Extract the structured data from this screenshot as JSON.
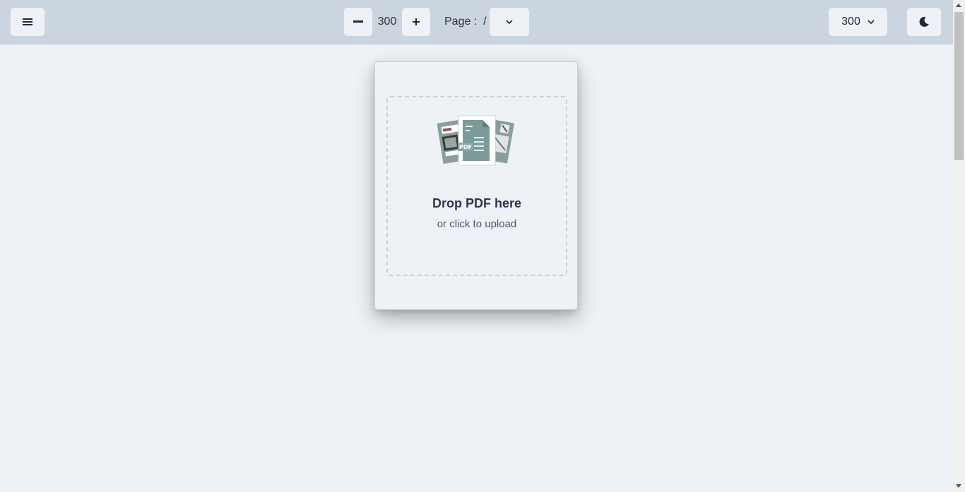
{
  "toolbar": {
    "menu_icon": "menu-icon",
    "zoom_out_icon": "minus-icon",
    "zoom_value": "300",
    "zoom_in_icon": "plus-icon",
    "page_label": "Page :  /",
    "page_select_icon": "chevron-down-icon",
    "scale_value": "300",
    "scale_icon": "chevron-down-icon",
    "theme_icon": "moon-icon"
  },
  "dropzone": {
    "title": "Drop PDF here",
    "subtitle": "or click to upload",
    "illustration_badge": "PDF"
  },
  "colors": {
    "toolbar_bg": "#cbd5e0",
    "page_bg": "#eef2f6",
    "illustration_accent": "#7a9b9a"
  }
}
